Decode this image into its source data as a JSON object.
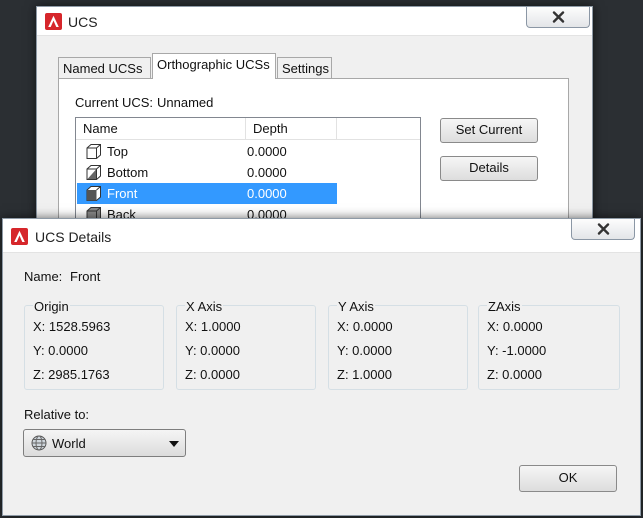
{
  "ucs_dialog": {
    "title": "UCS",
    "tabs": [
      "Named UCSs",
      "Orthographic UCSs",
      "Settings"
    ],
    "current_ucs_label": "Current UCS:",
    "current_ucs_value": "Unnamed",
    "columns": [
      "Name",
      "Depth"
    ],
    "rows": [
      {
        "name": "Top",
        "depth": "0.0000",
        "selected": false
      },
      {
        "name": "Bottom",
        "depth": "0.0000",
        "selected": false
      },
      {
        "name": "Front",
        "depth": "0.0000",
        "selected": true
      },
      {
        "name": "Back",
        "depth": "0.0000",
        "selected": false
      }
    ],
    "set_current_label": "Set Current",
    "details_label": "Details"
  },
  "details_dialog": {
    "title": "UCS Details",
    "name_label": "Name:",
    "name_value": "Front",
    "groups": [
      {
        "title": "Origin",
        "x": "X:  1528.5963",
        "y": "Y:  0.0000",
        "z": "Z:  2985.1763"
      },
      {
        "title": "X Axis",
        "x": "X:  1.0000",
        "y": "Y:  0.0000",
        "z": "Z:  0.0000"
      },
      {
        "title": "Y Axis",
        "x": "X:  0.0000",
        "y": "Y:  0.0000",
        "z": "Z:  1.0000"
      },
      {
        "title": "ZAxis",
        "x": "X:  0.0000",
        "y": "Y:  -1.0000",
        "z": "Z:  0.0000"
      }
    ],
    "relative_to_label": "Relative to:",
    "relative_to_value": "World",
    "ok_label": "OK"
  },
  "icons": {
    "app": "autocad-a-icon",
    "close": "close-x-icon",
    "ucs_view": "cube-view-icon",
    "world": "globe-icon",
    "dropdown": "triangle-down-icon"
  },
  "colors": {
    "selection": "#3399ff",
    "app_icon_red": "#d6262b"
  }
}
